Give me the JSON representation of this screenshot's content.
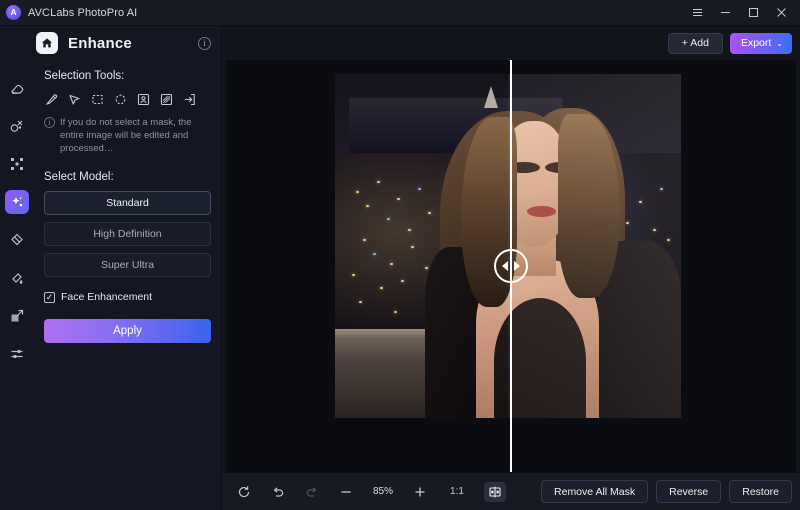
{
  "titlebar": {
    "app_name": "AVCLabs PhotoPro AI",
    "app_icon": "app-logo-icon",
    "menu_icon": "hamburger-menu-icon",
    "minimize_icon": "minimize-icon",
    "maximize_icon": "maximize-icon",
    "close_icon": "close-icon"
  },
  "rail": {
    "items": [
      {
        "name": "eraser-tool-icon",
        "active": false
      },
      {
        "name": "object-removal-icon",
        "active": false
      },
      {
        "name": "expand-icon",
        "active": false
      },
      {
        "name": "enhance-icon",
        "active": true
      },
      {
        "name": "background-remove-icon",
        "active": false
      },
      {
        "name": "colorize-icon",
        "active": false
      },
      {
        "name": "resize-icon",
        "active": false
      },
      {
        "name": "adjust-sliders-icon",
        "active": false
      }
    ]
  },
  "panel": {
    "home_icon": "home-icon",
    "title": "Enhance",
    "info_icon": "info-icon",
    "selection_tools_label": "Selection Tools:",
    "tools": [
      "brush-tool-icon",
      "cursor-select-icon",
      "rectangle-select-icon",
      "ellipse-select-icon",
      "portrait-select-icon",
      "pattern-select-icon",
      "arrow-export-icon"
    ],
    "hint_icon": "info-icon",
    "hint_text": "If you do not select a mask, the entire image will be edited and processed…",
    "model_label": "Select Model:",
    "models": [
      {
        "label": "Standard",
        "selected": true
      },
      {
        "label": "High Definition",
        "selected": false
      },
      {
        "label": "Super Ultra",
        "selected": false
      }
    ],
    "face_enhancement": {
      "label": "Face Enhancement",
      "checked": true,
      "check_glyph": "✓"
    },
    "apply_label": "Apply"
  },
  "main": {
    "add_label": "+ Add",
    "export_label": "Export",
    "export_caret": "⌄"
  },
  "canvas": {
    "compare_slider": "compare-slider-handle",
    "left_arrow": "arrow-left-icon",
    "right_arrow": "arrow-right-icon"
  },
  "bottombar": {
    "reset_icon": "reset-rotate-icon",
    "undo_icon": "undo-icon",
    "redo_icon": "redo-icon",
    "zoom_out_icon": "zoom-out-icon",
    "zoom_level": "85%",
    "zoom_in_icon": "zoom-in-icon",
    "actual_size_label": "1:1",
    "compare_view_icon": "split-compare-icon",
    "remove_all_mask_label": "Remove All Mask",
    "reverse_label": "Reverse",
    "restore_label": "Restore"
  },
  "colors": {
    "accent_purple": "#a855f7",
    "accent_blue": "#3b6ef5",
    "panel_bg": "#141721",
    "canvas_bg": "#0a0c12",
    "bottombar_bg": "#171a23"
  }
}
